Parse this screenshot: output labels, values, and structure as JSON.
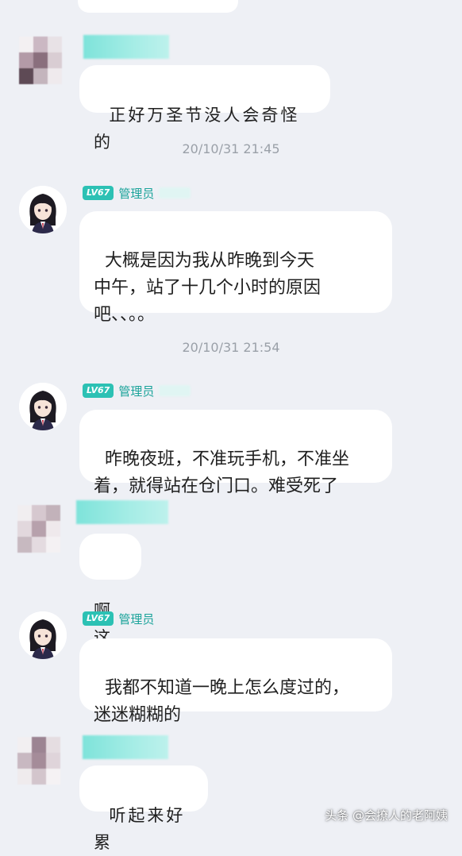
{
  "messages": [
    {
      "text": "正好万圣节没人会奇怪的"
    },
    {
      "text": "大概是因为我从昨晚到今天\n中午，站了十几个小时的原因\n吧、、。。"
    },
    {
      "text": "昨晚夜班，不准玩手机，不准坐\n着，就得站在仓门口。难受死了"
    },
    {
      "text": "啊这"
    },
    {
      "text": "我都不知道一晚上怎么度过的，\n迷迷糊糊的"
    },
    {
      "text": "听起来好累"
    }
  ],
  "timestamps": [
    "20/10/31 21:45",
    "20/10/31 21:54"
  ],
  "admin_badge": {
    "level": "LV67",
    "role": "管理员"
  },
  "watermark": "头条 @会撩人的老阿姨",
  "colors": {
    "background": "#eef0f5",
    "bubble": "#ffffff",
    "accent": "#2cc1b4",
    "timestamp": "#9aa0a8"
  },
  "icons": {
    "blurred_avatar": "pixelated-avatar-icon",
    "admin_avatar": "anime-girl-avatar-icon"
  }
}
